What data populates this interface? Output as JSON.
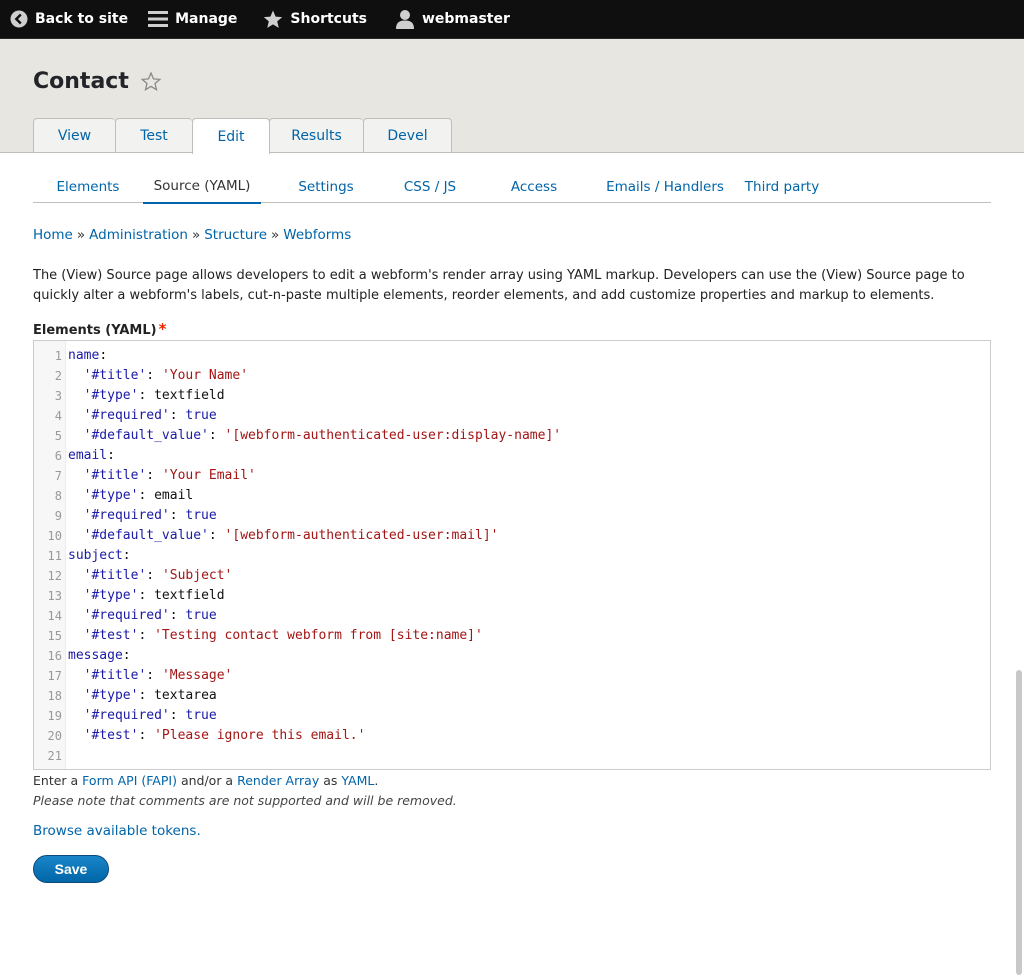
{
  "toolbar": {
    "back_label": "Back to site",
    "manage_label": "Manage",
    "shortcuts_label": "Shortcuts",
    "user_label": "webmaster"
  },
  "page": {
    "title": "Contact"
  },
  "primary_tabs": [
    {
      "label": "View",
      "active": false
    },
    {
      "label": "Test",
      "active": false
    },
    {
      "label": "Edit",
      "active": true
    },
    {
      "label": "Results",
      "active": false
    },
    {
      "label": "Devel",
      "active": false
    }
  ],
  "secondary_tabs": [
    {
      "label": "Elements",
      "active": false
    },
    {
      "label": "Source (YAML)",
      "active": true
    },
    {
      "label": "Settings",
      "active": false
    },
    {
      "label": "CSS / JS",
      "active": false
    },
    {
      "label": "Access",
      "active": false
    },
    {
      "label": "Emails / Handlers",
      "active": false
    },
    {
      "label": "Third party",
      "active": false
    }
  ],
  "breadcrumb": [
    {
      "label": "Home"
    },
    {
      "label": "Administration"
    },
    {
      "label": "Structure"
    },
    {
      "label": "Webforms"
    }
  ],
  "breadcrumb_separator": "»",
  "description": "The (View) Source page allows developers to edit a webform's render array using YAML markup. Developers can use the (View) Source page to quickly alter a webform's labels, cut-n-paste multiple elements, reorder elements, and add customize properties and markup to elements.",
  "field": {
    "label": "Elements (YAML)",
    "required_mark": "*"
  },
  "code_lines": [
    {
      "n": "1",
      "tokens": [
        {
          "t": "key",
          "v": "name"
        },
        {
          "t": "plain",
          "v": ":"
        }
      ]
    },
    {
      "n": "2",
      "tokens": [
        {
          "t": "plain",
          "v": "  "
        },
        {
          "t": "key",
          "v": "'#title'"
        },
        {
          "t": "plain",
          "v": ": "
        },
        {
          "t": "str",
          "v": "'Your Name'"
        }
      ]
    },
    {
      "n": "3",
      "tokens": [
        {
          "t": "plain",
          "v": "  "
        },
        {
          "t": "key",
          "v": "'#type'"
        },
        {
          "t": "plain",
          "v": ": textfield"
        }
      ]
    },
    {
      "n": "4",
      "tokens": [
        {
          "t": "plain",
          "v": "  "
        },
        {
          "t": "key",
          "v": "'#required'"
        },
        {
          "t": "plain",
          "v": ": "
        },
        {
          "t": "bool",
          "v": "true"
        }
      ]
    },
    {
      "n": "5",
      "tokens": [
        {
          "t": "plain",
          "v": "  "
        },
        {
          "t": "key",
          "v": "'#default_value'"
        },
        {
          "t": "plain",
          "v": ": "
        },
        {
          "t": "str",
          "v": "'[webform-authenticated-user:display-name]'"
        }
      ]
    },
    {
      "n": "6",
      "tokens": [
        {
          "t": "key",
          "v": "email"
        },
        {
          "t": "plain",
          "v": ":"
        }
      ]
    },
    {
      "n": "7",
      "tokens": [
        {
          "t": "plain",
          "v": "  "
        },
        {
          "t": "key",
          "v": "'#title'"
        },
        {
          "t": "plain",
          "v": ": "
        },
        {
          "t": "str",
          "v": "'Your Email'"
        }
      ]
    },
    {
      "n": "8",
      "tokens": [
        {
          "t": "plain",
          "v": "  "
        },
        {
          "t": "key",
          "v": "'#type'"
        },
        {
          "t": "plain",
          "v": ": email"
        }
      ]
    },
    {
      "n": "9",
      "tokens": [
        {
          "t": "plain",
          "v": "  "
        },
        {
          "t": "key",
          "v": "'#required'"
        },
        {
          "t": "plain",
          "v": ": "
        },
        {
          "t": "bool",
          "v": "true"
        }
      ]
    },
    {
      "n": "10",
      "tokens": [
        {
          "t": "plain",
          "v": "  "
        },
        {
          "t": "key",
          "v": "'#default_value'"
        },
        {
          "t": "plain",
          "v": ": "
        },
        {
          "t": "str",
          "v": "'[webform-authenticated-user:mail]'"
        }
      ]
    },
    {
      "n": "11",
      "tokens": [
        {
          "t": "key",
          "v": "subject"
        },
        {
          "t": "plain",
          "v": ":"
        }
      ]
    },
    {
      "n": "12",
      "tokens": [
        {
          "t": "plain",
          "v": "  "
        },
        {
          "t": "key",
          "v": "'#title'"
        },
        {
          "t": "plain",
          "v": ": "
        },
        {
          "t": "str",
          "v": "'Subject'"
        }
      ]
    },
    {
      "n": "13",
      "tokens": [
        {
          "t": "plain",
          "v": "  "
        },
        {
          "t": "key",
          "v": "'#type'"
        },
        {
          "t": "plain",
          "v": ": textfield"
        }
      ]
    },
    {
      "n": "14",
      "tokens": [
        {
          "t": "plain",
          "v": "  "
        },
        {
          "t": "key",
          "v": "'#required'"
        },
        {
          "t": "plain",
          "v": ": "
        },
        {
          "t": "bool",
          "v": "true"
        }
      ]
    },
    {
      "n": "15",
      "tokens": [
        {
          "t": "plain",
          "v": "  "
        },
        {
          "t": "key",
          "v": "'#test'"
        },
        {
          "t": "plain",
          "v": ": "
        },
        {
          "t": "str",
          "v": "'Testing contact webform from [site:name]'"
        }
      ]
    },
    {
      "n": "16",
      "tokens": [
        {
          "t": "key",
          "v": "message"
        },
        {
          "t": "plain",
          "v": ":"
        }
      ]
    },
    {
      "n": "17",
      "tokens": [
        {
          "t": "plain",
          "v": "  "
        },
        {
          "t": "key",
          "v": "'#title'"
        },
        {
          "t": "plain",
          "v": ": "
        },
        {
          "t": "str",
          "v": "'Message'"
        }
      ]
    },
    {
      "n": "18",
      "tokens": [
        {
          "t": "plain",
          "v": "  "
        },
        {
          "t": "key",
          "v": "'#type'"
        },
        {
          "t": "plain",
          "v": ": textarea"
        }
      ]
    },
    {
      "n": "19",
      "tokens": [
        {
          "t": "plain",
          "v": "  "
        },
        {
          "t": "key",
          "v": "'#required'"
        },
        {
          "t": "plain",
          "v": ": "
        },
        {
          "t": "bool",
          "v": "true"
        }
      ]
    },
    {
      "n": "20",
      "tokens": [
        {
          "t": "plain",
          "v": "  "
        },
        {
          "t": "key",
          "v": "'#test'"
        },
        {
          "t": "plain",
          "v": ": "
        },
        {
          "t": "str",
          "v": "'Please ignore this email.'"
        }
      ]
    },
    {
      "n": "21",
      "tokens": []
    }
  ],
  "help": {
    "prefix": "Enter a ",
    "fapi_link": "Form API (FAPI)",
    "middle": " and/or a ",
    "render_array_link": "Render Array",
    "as_text": " as ",
    "yaml_link": "YAML",
    "suffix": ".",
    "note": "Please note that comments are not supported and will be removed."
  },
  "tokens_link": "Browse available tokens.",
  "save_label": "Save",
  "icons": {
    "back": "back-arrow-circle-icon",
    "manage": "hamburger-menu-icon",
    "shortcuts": "star-icon",
    "user": "user-icon",
    "favorite": "star-outline-icon"
  },
  "colors": {
    "toolbar_bg": "#0f0f0f",
    "header_bg": "#e7e6e1",
    "link": "#0064a8",
    "yaml_key": "#1a1aa6",
    "yaml_string": "#a31515",
    "required": "#e62600",
    "button": "#0071b8"
  }
}
